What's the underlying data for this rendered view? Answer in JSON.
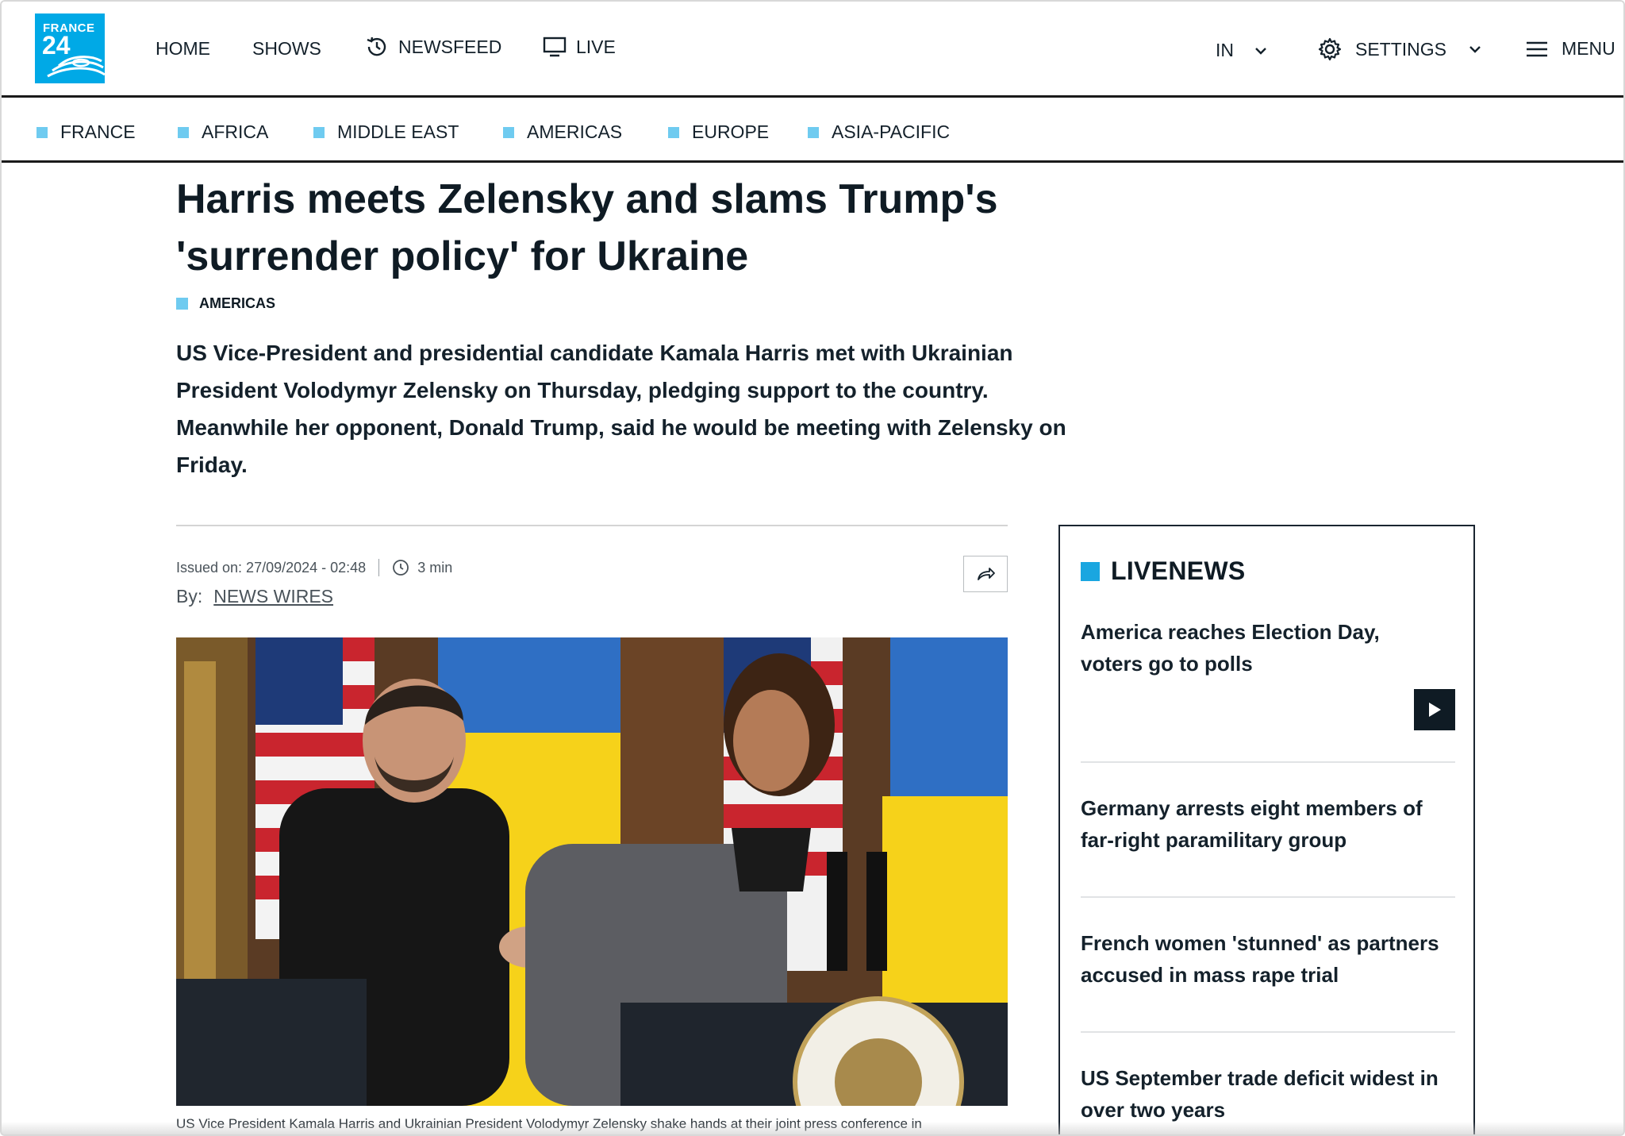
{
  "colors": {
    "accent": "#00a9e6",
    "region_square": "#6fcbf0",
    "text": "#14212b"
  },
  "logo": {
    "line1": "FRANCE",
    "line2": "24"
  },
  "header": {
    "nav": [
      {
        "label": "HOME"
      },
      {
        "label": "SHOWS"
      },
      {
        "label": "NEWSFEED",
        "icon": "history-clock-icon"
      },
      {
        "label": "LIVE",
        "icon": "tv-monitor-icon"
      }
    ],
    "edition": "IN",
    "settings": "SETTINGS",
    "menu": "MENU"
  },
  "regions": [
    "FRANCE",
    "AFRICA",
    "MIDDLE EAST",
    "AMERICAS",
    "EUROPE",
    "ASIA-PACIFIC"
  ],
  "article": {
    "headline_line1": "Harris meets Zelensky and slams Trump's",
    "headline_line2": "'surrender policy' for Ukraine",
    "category": "AMERICAS",
    "lede_lines": [
      "US Vice-President and presidential candidate Kamala Harris met with Ukrainian",
      "President Volodymyr Zelensky on Thursday, pledging support to the country.",
      "Meanwhile her opponent, Donald Trump, said he would be meeting with Zelensky on",
      "Friday."
    ],
    "issued_on": "Issued on: 27/09/2024 - 02:48",
    "read_time": "3 min",
    "by_label": "By:",
    "author": "NEWS WIRES",
    "caption": "US Vice President Kamala Harris and Ukrainian President Volodymyr Zelensky shake hands at their joint press conference in"
  },
  "livenews": {
    "title": "LIVENEWS",
    "items": [
      {
        "line1": "America reaches Election Day,",
        "line2": "voters go to polls"
      },
      {
        "line1": "Germany arrests eight members of",
        "line2": "far-right paramilitary group"
      },
      {
        "line1": "French women 'stunned' as partners",
        "line2": "accused in mass rape trial"
      },
      {
        "line1": "US September trade deficit widest in",
        "line2": "over two years"
      }
    ]
  }
}
